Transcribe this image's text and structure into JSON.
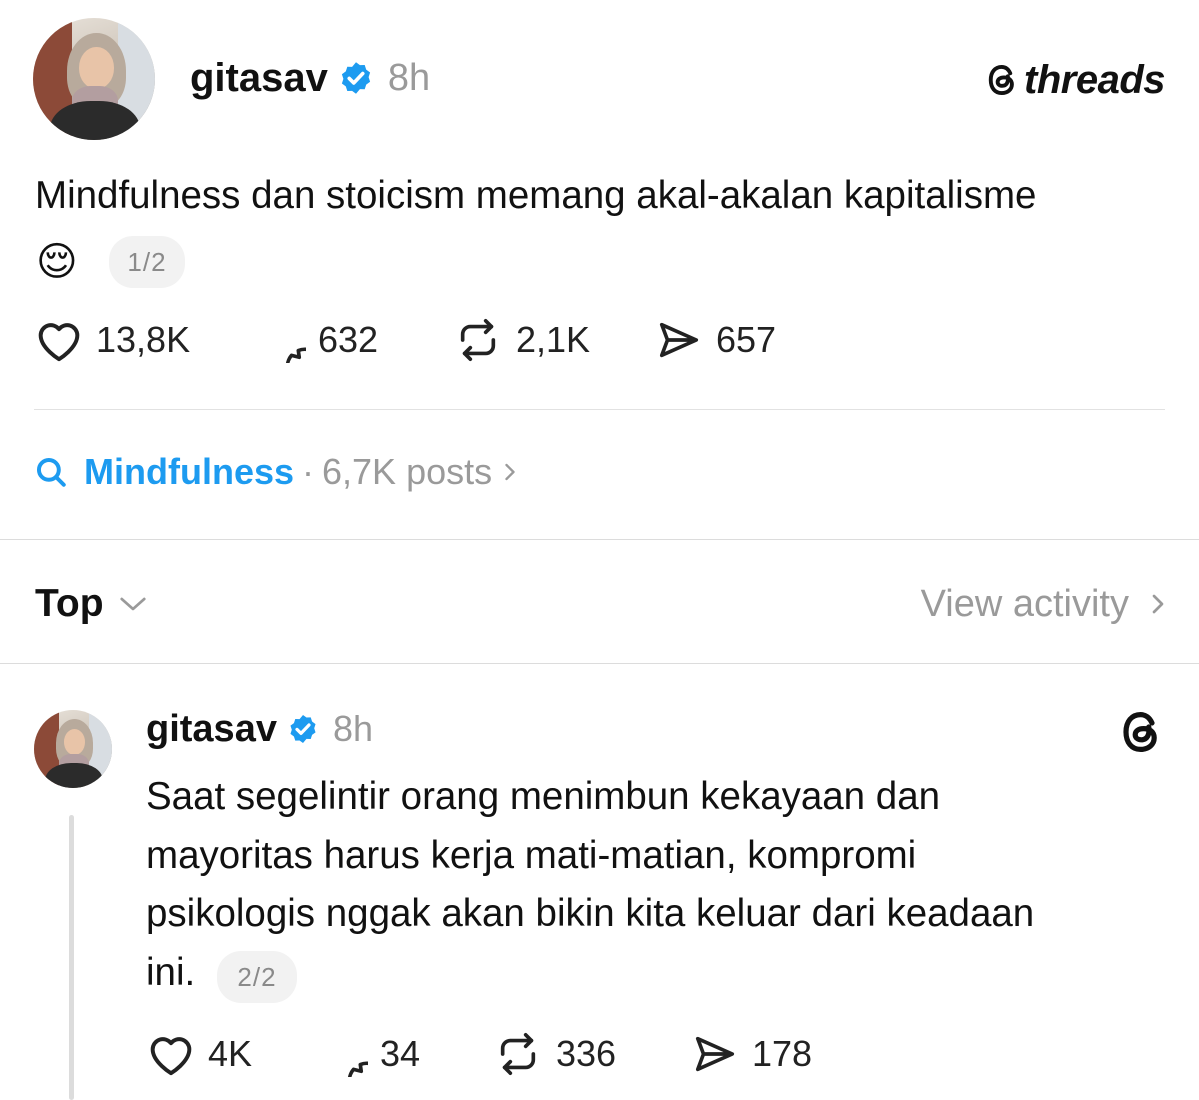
{
  "post": {
    "username": "gitasav",
    "time": "8h",
    "brand": "threads",
    "text": "Mindfulness dan stoicism memang akal-akalan kapitalisme",
    "emoji": "😌",
    "page_indicator": "1/2",
    "stats": {
      "likes": "13,8K",
      "replies": "632",
      "reposts": "2,1K",
      "shares": "657"
    }
  },
  "topic": {
    "tag": "Mindfulness",
    "separator": "·",
    "count": "6,7K posts"
  },
  "sort": {
    "label": "Top",
    "view_activity": "View activity"
  },
  "reply": {
    "username": "gitasav",
    "time": "8h",
    "lines": [
      "Saat segelintir orang menimbun kekayaan dan",
      "mayoritas harus kerja mati-matian, kompromi",
      "psikologis nggak akan bikin kita keluar dari keadaan",
      "ini."
    ],
    "page_indicator": "2/2",
    "stats": {
      "likes": "4K",
      "replies": "34",
      "reposts": "336",
      "shares": "178"
    }
  },
  "colors": {
    "accent": "#1d9bf0",
    "muted": "#9a9a9a",
    "divider": "#e2e2e2"
  },
  "icons": [
    "verified-badge-icon",
    "threads-logo-icon",
    "heart-icon",
    "comment-icon",
    "repost-icon",
    "share-icon",
    "search-icon",
    "chevron-down-icon",
    "chevron-right-icon"
  ]
}
